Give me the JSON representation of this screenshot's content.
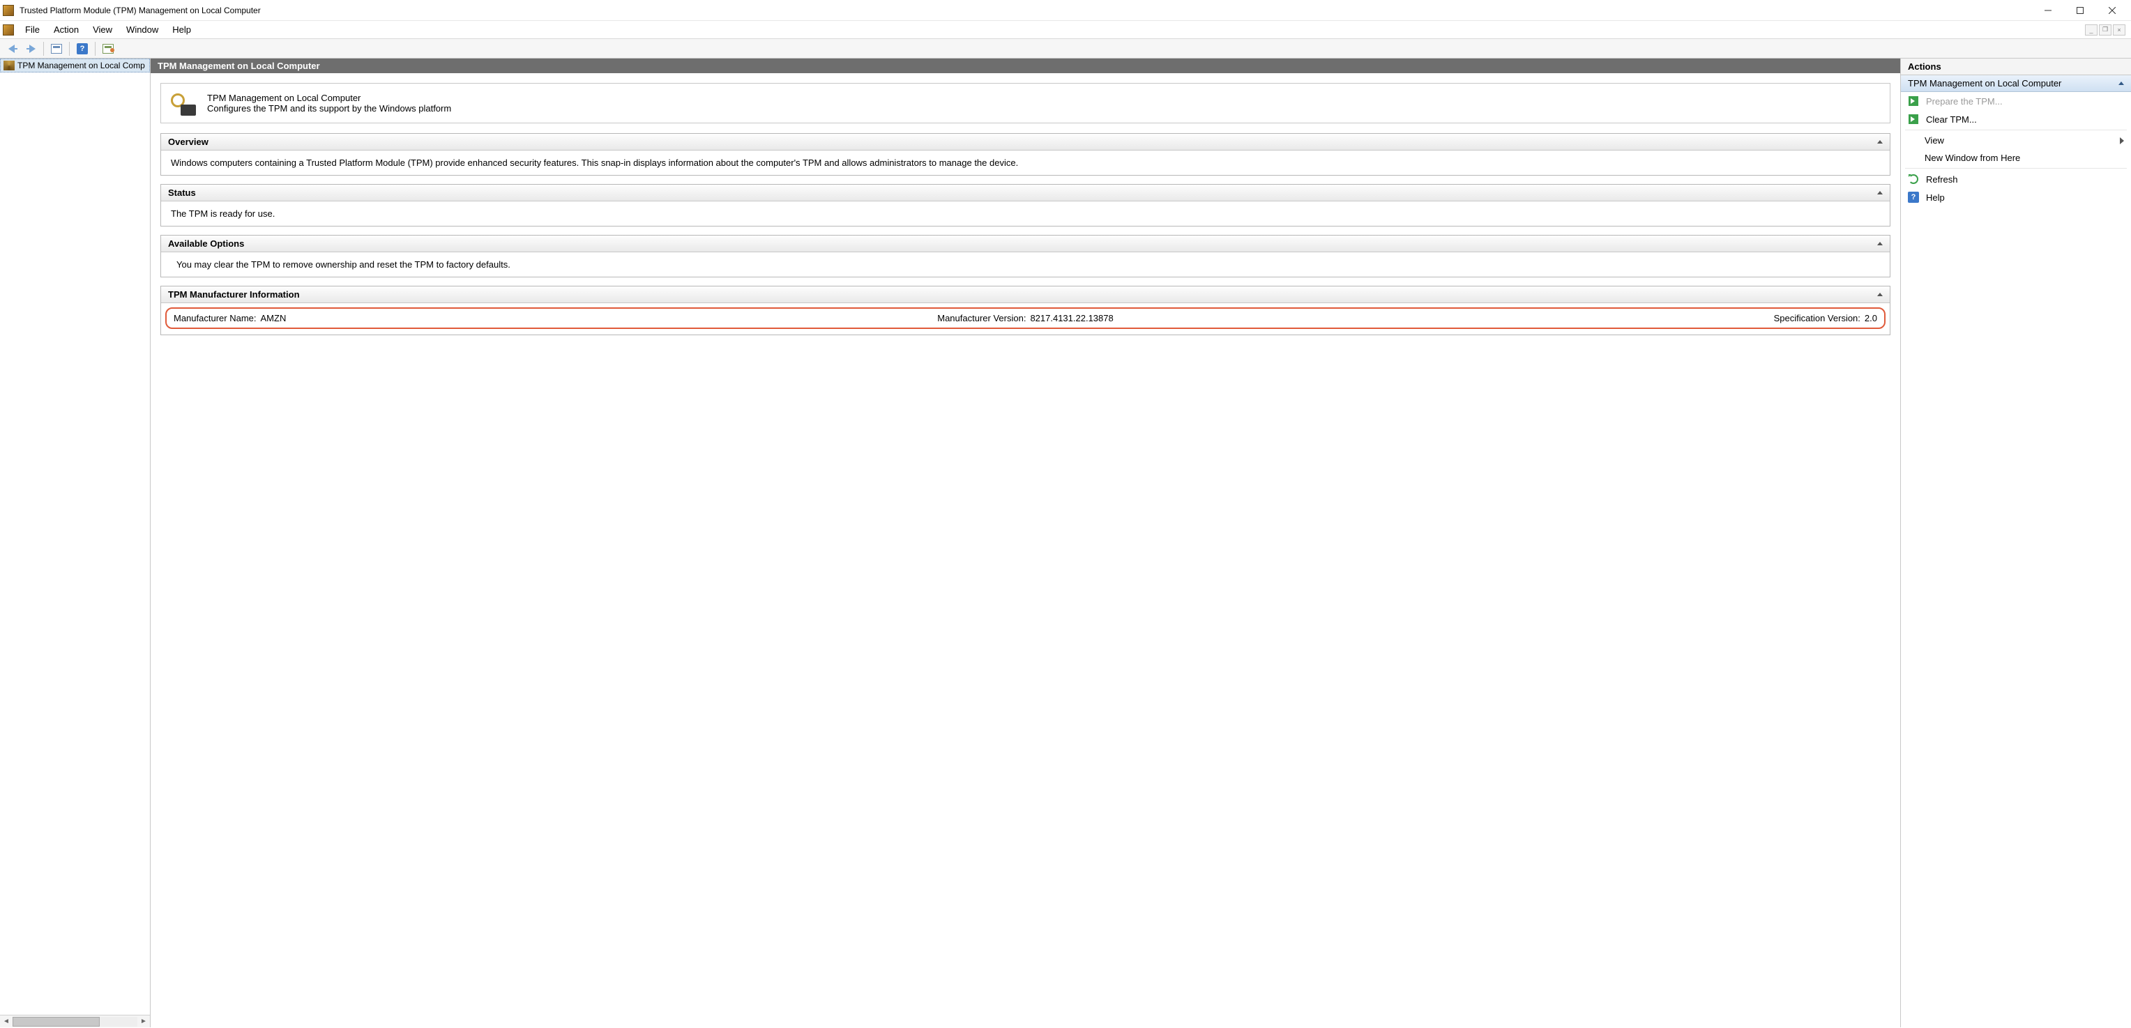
{
  "window": {
    "title": "Trusted Platform Module (TPM) Management on Local Computer"
  },
  "menu": {
    "file": "File",
    "action": "Action",
    "view": "View",
    "window": "Window",
    "help": "Help"
  },
  "tree": {
    "root": "TPM Management on Local Comp"
  },
  "center": {
    "header": "TPM Management on Local Computer",
    "intro_title": "TPM Management on Local Computer",
    "intro_desc": "Configures the TPM and its support by the Windows platform",
    "sections": {
      "overview": {
        "title": "Overview",
        "body": "Windows computers containing a Trusted Platform Module (TPM) provide enhanced security features. This snap-in displays information about the computer's TPM and allows administrators to manage the device."
      },
      "status": {
        "title": "Status",
        "body": "The TPM is ready for use."
      },
      "options": {
        "title": "Available Options",
        "body": "You may clear the TPM to remove ownership and reset the TPM to factory defaults."
      },
      "mfr": {
        "title": "TPM Manufacturer Information",
        "name_label": "Manufacturer Name:",
        "name_value": "AMZN",
        "ver_label": "Manufacturer Version:",
        "ver_value": "8217.4131.22.13878",
        "spec_label": "Specification Version:",
        "spec_value": "2.0"
      }
    }
  },
  "actions": {
    "title": "Actions",
    "subtitle": "TPM Management on Local Computer",
    "prepare": "Prepare the TPM...",
    "clear": "Clear TPM...",
    "view": "View",
    "new_window": "New Window from Here",
    "refresh": "Refresh",
    "help": "Help"
  }
}
